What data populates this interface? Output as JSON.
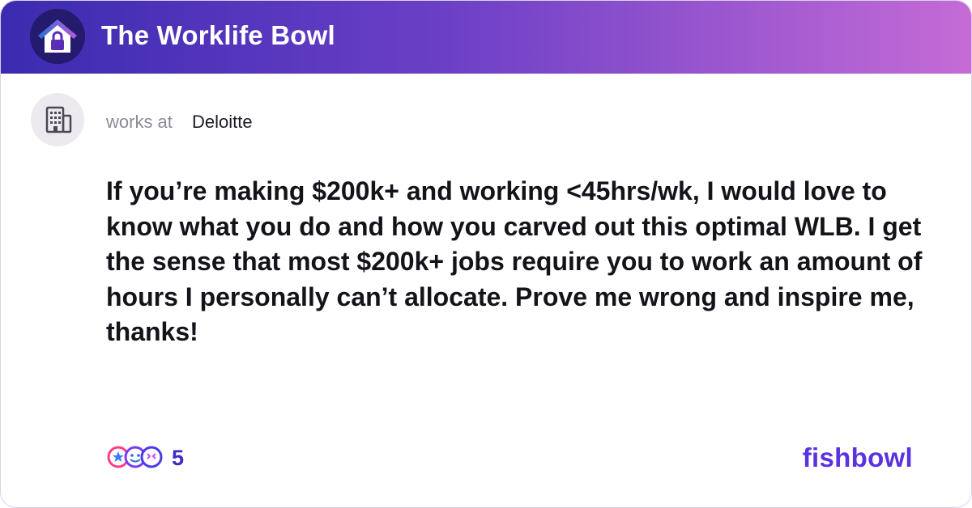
{
  "header": {
    "title": "The Worklife Bowl"
  },
  "author": {
    "works_at_label": "works at",
    "company": "Deloitte",
    "icon": "building-icon"
  },
  "post": {
    "text": "If you’re making $200k+ and working <45hrs/wk, I would love to know what you do and how you carved out this optimal WLB. I get the sense that most $200k+ jobs require you to work an amount of hours I personally can’t allocate. Prove me wrong and inspire me, thanks!"
  },
  "footer": {
    "reaction_count": "5",
    "brand": "fishbowl"
  },
  "colors": {
    "header_start": "#3b2bb0",
    "header_end": "#c56bd6",
    "brand": "#5b32e0",
    "reaction_count": "#3d2bc6"
  }
}
